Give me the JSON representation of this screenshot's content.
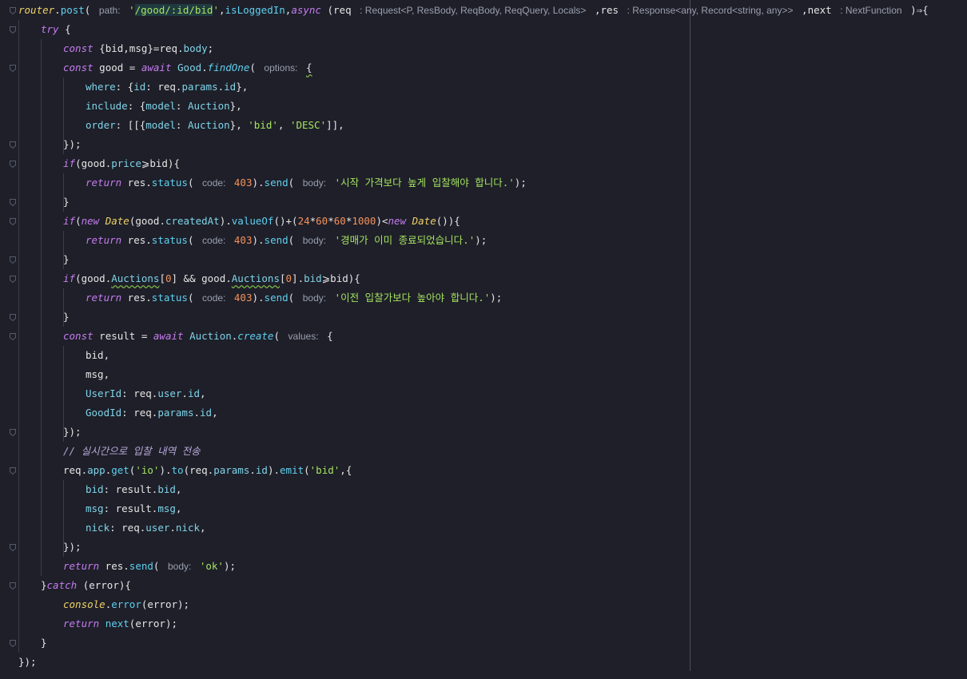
{
  "colors": {
    "background": "#1e1f29",
    "keyword": "#c67cf0",
    "function": "#5fd0ef",
    "property": "#7fd4e8",
    "string": "#a5e35f",
    "number": "#f5915a",
    "type": "#f0d266",
    "default": "#e6e6e6",
    "hint": "#9aa0ae",
    "comment": "#b9a8d8"
  },
  "lines": [
    [
      [
        "router",
        "tf"
      ],
      [
        ".",
        "p"
      ],
      [
        "post",
        "f"
      ],
      [
        "( ",
        "p"
      ],
      [
        "path:",
        "h"
      ],
      [
        " ",
        ""
      ],
      [
        "'",
        "s"
      ],
      [
        "/good/:id/bid",
        "s hl"
      ],
      [
        "'",
        "s"
      ],
      [
        ",",
        "p"
      ],
      [
        "isLoggedIn",
        "f"
      ],
      [
        ",",
        "p"
      ],
      [
        "async",
        "k"
      ],
      [
        " (",
        "p"
      ],
      [
        "req",
        "d"
      ],
      [
        " ",
        ""
      ],
      [
        ": Request<P, ResBody, ReqBody, ReqQuery, Locals>",
        "h"
      ],
      [
        " ,",
        "p"
      ],
      [
        "res",
        "d"
      ],
      [
        " ",
        ""
      ],
      [
        ": Response<any, Record<string, any>>",
        "h"
      ],
      [
        " ,",
        "p"
      ],
      [
        "next",
        "d"
      ],
      [
        " ",
        ""
      ],
      [
        ": NextFunction",
        "h"
      ],
      [
        " )⇒{",
        "p"
      ]
    ],
    [
      [
        "try",
        "k"
      ],
      [
        " {",
        "p"
      ]
    ],
    [
      [
        "const",
        "k"
      ],
      [
        " {bid,msg}=",
        "d"
      ],
      [
        "req",
        "d"
      ],
      [
        ".",
        "p"
      ],
      [
        "body",
        "a"
      ],
      [
        ";",
        "p"
      ]
    ],
    [
      [
        "const",
        "k"
      ],
      [
        " good = ",
        "d"
      ],
      [
        "await",
        "k"
      ],
      [
        " ",
        ""
      ],
      [
        "Good",
        "a"
      ],
      [
        ".",
        "p"
      ],
      [
        "findOne",
        "fi"
      ],
      [
        "( ",
        "p"
      ],
      [
        "options:",
        "h"
      ],
      [
        " ",
        ""
      ],
      [
        "{",
        "p w"
      ]
    ],
    [
      [
        "where",
        "a"
      ],
      [
        ": {",
        "p"
      ],
      [
        "id",
        "a"
      ],
      [
        ": req.",
        "d"
      ],
      [
        "params",
        "a"
      ],
      [
        ".",
        "p"
      ],
      [
        "id",
        "a"
      ],
      [
        "},",
        "p"
      ]
    ],
    [
      [
        "include",
        "a"
      ],
      [
        ": {",
        "p"
      ],
      [
        "model",
        "a"
      ],
      [
        ": ",
        "p"
      ],
      [
        "Auction",
        "a"
      ],
      [
        "},",
        "p"
      ]
    ],
    [
      [
        "order",
        "a"
      ],
      [
        ": [[{",
        "p"
      ],
      [
        "model",
        "a"
      ],
      [
        ": ",
        "p"
      ],
      [
        "Auction",
        "a"
      ],
      [
        "}, ",
        "p"
      ],
      [
        "'bid'",
        "s"
      ],
      [
        ", ",
        "p"
      ],
      [
        "'DESC'",
        "s"
      ],
      [
        "]],",
        "p"
      ]
    ],
    [
      [
        "});",
        "p"
      ]
    ],
    [
      [
        "if",
        "k"
      ],
      [
        "(good.",
        "d"
      ],
      [
        "price",
        "a"
      ],
      [
        "⩾",
        "p"
      ],
      [
        "bid){",
        "d"
      ]
    ],
    [
      [
        "return",
        "k"
      ],
      [
        " res.",
        "d"
      ],
      [
        "status",
        "f"
      ],
      [
        "( ",
        "p"
      ],
      [
        "code:",
        "h"
      ],
      [
        " ",
        ""
      ],
      [
        "403",
        "n"
      ],
      [
        ").",
        "p"
      ],
      [
        "send",
        "f"
      ],
      [
        "( ",
        "p"
      ],
      [
        "body:",
        "h"
      ],
      [
        " ",
        ""
      ],
      [
        "'시작 가격보다 높게 입찰해야 합니다.'",
        "s"
      ],
      [
        ");",
        "p"
      ]
    ],
    [
      [
        "}",
        "p"
      ]
    ],
    [
      [
        "if",
        "k"
      ],
      [
        "(",
        "p"
      ],
      [
        "new",
        "k"
      ],
      [
        " ",
        ""
      ],
      [
        "Date",
        "tf"
      ],
      [
        "(good.",
        "d"
      ],
      [
        "createdAt",
        "a"
      ],
      [
        ").",
        "p"
      ],
      [
        "valueOf",
        "f"
      ],
      [
        "()+(",
        "p"
      ],
      [
        "24",
        "n"
      ],
      [
        "*",
        "p"
      ],
      [
        "60",
        "n"
      ],
      [
        "*",
        "p"
      ],
      [
        "60",
        "n"
      ],
      [
        "*",
        "p"
      ],
      [
        "1000",
        "n"
      ],
      [
        ")<",
        "p"
      ],
      [
        "new",
        "k"
      ],
      [
        " ",
        ""
      ],
      [
        "Date",
        "tf"
      ],
      [
        "()){",
        "p"
      ]
    ],
    [
      [
        "return",
        "k"
      ],
      [
        " res.",
        "d"
      ],
      [
        "status",
        "f"
      ],
      [
        "( ",
        "p"
      ],
      [
        "code:",
        "h"
      ],
      [
        " ",
        ""
      ],
      [
        "403",
        "n"
      ],
      [
        ").",
        "p"
      ],
      [
        "send",
        "f"
      ],
      [
        "( ",
        "p"
      ],
      [
        "body:",
        "h"
      ],
      [
        " ",
        ""
      ],
      [
        "'경매가 이미 종료되었습니다.'",
        "s"
      ],
      [
        ");",
        "p"
      ]
    ],
    [
      [
        "}",
        "p"
      ]
    ],
    [
      [
        "if",
        "k"
      ],
      [
        "(good.",
        "d"
      ],
      [
        "Auctions",
        "a w"
      ],
      [
        "[",
        "p"
      ],
      [
        "0",
        "n"
      ],
      [
        "] && good.",
        "d"
      ],
      [
        "Auctions",
        "a w"
      ],
      [
        "[",
        "p"
      ],
      [
        "0",
        "n"
      ],
      [
        "].",
        "p"
      ],
      [
        "bid",
        "a"
      ],
      [
        "⩾",
        "p"
      ],
      [
        "bid){",
        "d"
      ]
    ],
    [
      [
        "return",
        "k"
      ],
      [
        " res.",
        "d"
      ],
      [
        "status",
        "f"
      ],
      [
        "( ",
        "p"
      ],
      [
        "code:",
        "h"
      ],
      [
        " ",
        ""
      ],
      [
        "403",
        "n"
      ],
      [
        ").",
        "p"
      ],
      [
        "send",
        "f"
      ],
      [
        "( ",
        "p"
      ],
      [
        "body:",
        "h"
      ],
      [
        " ",
        ""
      ],
      [
        "'이전 입찰가보다 높아야 합니다.'",
        "s"
      ],
      [
        ");",
        "p"
      ]
    ],
    [
      [
        "}",
        "p"
      ]
    ],
    [
      [
        "const",
        "k"
      ],
      [
        " result = ",
        "d"
      ],
      [
        "await",
        "k"
      ],
      [
        " ",
        ""
      ],
      [
        "Auction",
        "a"
      ],
      [
        ".",
        "p"
      ],
      [
        "create",
        "fi"
      ],
      [
        "( ",
        "p"
      ],
      [
        "values:",
        "h"
      ],
      [
        " {",
        "p"
      ]
    ],
    [
      [
        "bid,",
        "d"
      ]
    ],
    [
      [
        "msg,",
        "d"
      ]
    ],
    [
      [
        "UserId",
        "a"
      ],
      [
        ": req.",
        "d"
      ],
      [
        "user",
        "a"
      ],
      [
        ".",
        "p"
      ],
      [
        "id",
        "a"
      ],
      [
        ",",
        "p"
      ]
    ],
    [
      [
        "GoodId",
        "a"
      ],
      [
        ": req.",
        "d"
      ],
      [
        "params",
        "a"
      ],
      [
        ".",
        "p"
      ],
      [
        "id",
        "a"
      ],
      [
        ",",
        "p"
      ]
    ],
    [
      [
        "});",
        "p"
      ]
    ],
    [
      [
        "// 실시간으로 입찰 내역 전송",
        "c"
      ]
    ],
    [
      [
        "req.",
        "d"
      ],
      [
        "app",
        "a"
      ],
      [
        ".",
        "p"
      ],
      [
        "get",
        "f"
      ],
      [
        "(",
        "p"
      ],
      [
        "'io'",
        "s"
      ],
      [
        ").",
        "p"
      ],
      [
        "to",
        "f"
      ],
      [
        "(req.",
        "d"
      ],
      [
        "params",
        "a"
      ],
      [
        ".",
        "p"
      ],
      [
        "id",
        "a"
      ],
      [
        ").",
        "p"
      ],
      [
        "emit",
        "f"
      ],
      [
        "(",
        "p"
      ],
      [
        "'bid'",
        "s"
      ],
      [
        ",{",
        "p"
      ]
    ],
    [
      [
        "bid",
        "a"
      ],
      [
        ": result.",
        "d"
      ],
      [
        "bid",
        "a"
      ],
      [
        ",",
        "p"
      ]
    ],
    [
      [
        "msg",
        "a"
      ],
      [
        ": result.",
        "d"
      ],
      [
        "msg",
        "a"
      ],
      [
        ",",
        "p"
      ]
    ],
    [
      [
        "nick",
        "a"
      ],
      [
        ": req.",
        "d"
      ],
      [
        "user",
        "a"
      ],
      [
        ".",
        "p"
      ],
      [
        "nick",
        "a"
      ],
      [
        ",",
        "p"
      ]
    ],
    [
      [
        "});",
        "p"
      ]
    ],
    [
      [
        "return",
        "k"
      ],
      [
        " res.",
        "d"
      ],
      [
        "send",
        "f"
      ],
      [
        "( ",
        "p"
      ],
      [
        "body:",
        "h"
      ],
      [
        " ",
        ""
      ],
      [
        "'ok'",
        "s"
      ],
      [
        ");",
        "p"
      ]
    ],
    [
      [
        "}",
        "p"
      ],
      [
        "catch",
        "k"
      ],
      [
        " (error){",
        "d"
      ]
    ],
    [
      [
        "console",
        "tf"
      ],
      [
        ".",
        "p"
      ],
      [
        "error",
        "f"
      ],
      [
        "(error);",
        "d"
      ]
    ],
    [
      [
        "return",
        "k"
      ],
      [
        " ",
        ""
      ],
      [
        "next",
        "f"
      ],
      [
        "(error);",
        "d"
      ]
    ],
    [
      [
        "}",
        "p"
      ]
    ],
    [
      [
        "});",
        "p"
      ]
    ]
  ]
}
